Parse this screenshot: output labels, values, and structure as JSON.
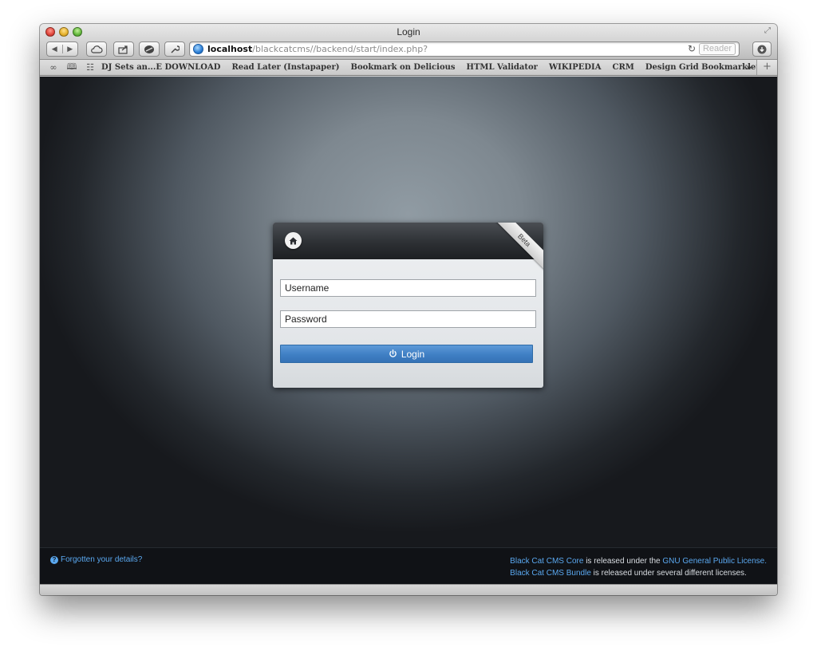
{
  "window": {
    "title": "Login"
  },
  "toolbar": {
    "url_host": "localhost",
    "url_path": "/blackcatcms//backend/start/index.php?",
    "reader_label": "Reader"
  },
  "bookmarks": [
    "DJ Sets an...E DOWNLOAD",
    "Read Later (Instapaper)",
    "Bookmark on Delicious",
    "HTML Validator",
    "WIKIPEDIA",
    "CRM",
    "Design Grid Bookmarklet"
  ],
  "login": {
    "badge": "Beta",
    "username_placeholder": "Username",
    "password_placeholder": "Password",
    "submit_label": "Login"
  },
  "footer": {
    "forgot_label": "Forgotten your details?",
    "line1": {
      "link1": "Black Cat CMS Core",
      "text1": " is released under the ",
      "link2": "GNU General Public License."
    },
    "line2": {
      "link1": "Black Cat CMS Bundle",
      "text1": " is released under several different licenses."
    }
  },
  "colors": {
    "accent_blue": "#3f7fc4",
    "link_blue": "#5aa8f0",
    "footer_bg": "#101216"
  }
}
